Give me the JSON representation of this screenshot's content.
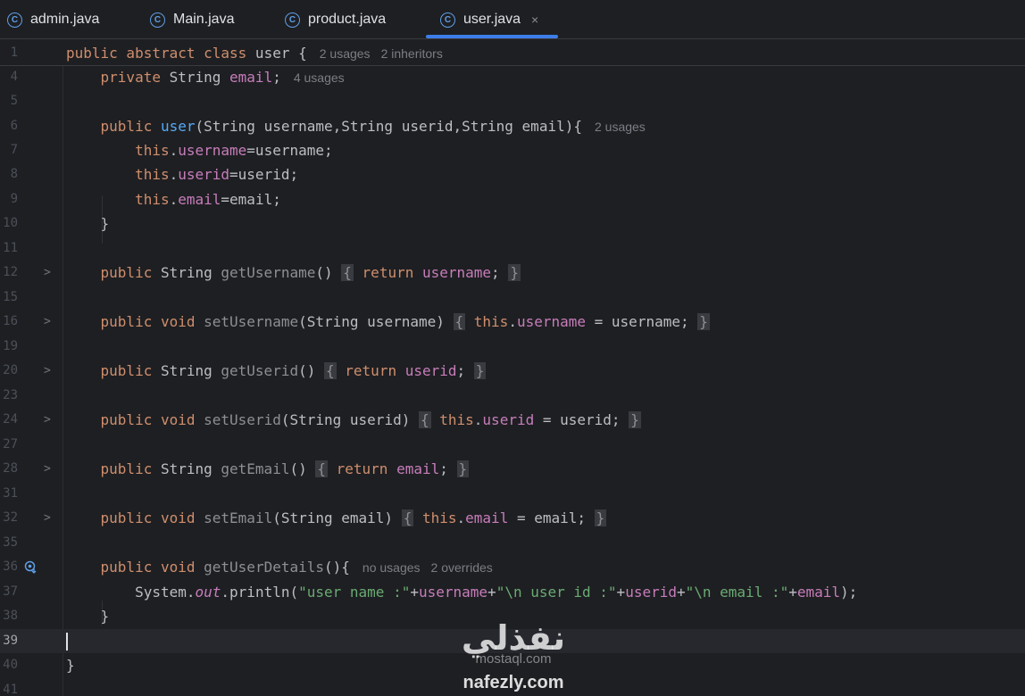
{
  "tabs": [
    {
      "label": "admin.java",
      "icon": "java-class-icon"
    },
    {
      "label": "Main.java",
      "icon": "java-class-icon"
    },
    {
      "label": "product.java",
      "icon": "java-class-icon"
    },
    {
      "label": "user.java",
      "icon": "java-class-icon",
      "active": true,
      "close": "×"
    }
  ],
  "class_icon_glyph": "C",
  "hints": {
    "usages2": "2 usages",
    "inheritors2": "2 inheritors",
    "usages4": "4 usages",
    "no_usages": "no usages",
    "overrides2": "2 overrides"
  },
  "lines": {
    "l1": "1",
    "l4": "4",
    "l5": "5",
    "l6": "6",
    "l7": "7",
    "l8": "8",
    "l9": "9",
    "l10": "10",
    "l11": "11",
    "l12": "12",
    "l15": "15",
    "l16": "16",
    "l19": "19",
    "l20": "20",
    "l23": "23",
    "l24": "24",
    "l27": "27",
    "l28": "28",
    "l31": "31",
    "l32": "32",
    "l35": "35",
    "l36": "36",
    "l37": "37",
    "l38": "38",
    "l39": "39",
    "l40": "40",
    "l41": "41"
  },
  "fold_glyph": ">",
  "watermark": {
    "arabic": "نفذلي",
    "sub": "mostaql.com",
    "domain": "nafezly.com"
  },
  "colors": {
    "keyword": "#cf8e6d",
    "function": "#56a8f5",
    "field": "#c77dbb",
    "string": "#6aab73",
    "accent": "#3d7de8"
  }
}
